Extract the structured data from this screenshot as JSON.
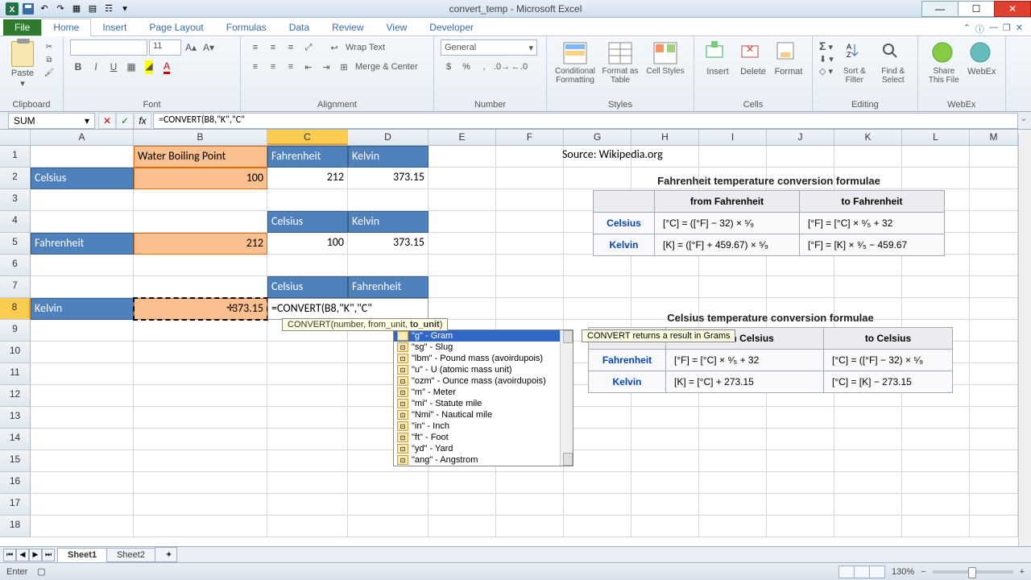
{
  "title": "convert_temp - Microsoft Excel",
  "tabs": {
    "file": "File",
    "list": [
      "Home",
      "Insert",
      "Page Layout",
      "Formulas",
      "Data",
      "Review",
      "View",
      "Developer"
    ],
    "active": 0
  },
  "ribbon": {
    "clipboard": {
      "label": "Clipboard",
      "paste": "Paste"
    },
    "font": {
      "label": "Font",
      "size": "11"
    },
    "alignment": {
      "label": "Alignment",
      "wrap": "Wrap Text",
      "merge": "Merge & Center"
    },
    "number": {
      "label": "Number",
      "format": "General"
    },
    "styles": {
      "label": "Styles",
      "cond": "Conditional Formatting",
      "table": "Format as Table",
      "cell": "Cell Styles"
    },
    "cells": {
      "label": "Cells",
      "insert": "Insert",
      "delete": "Delete",
      "format": "Format"
    },
    "editing": {
      "label": "Editing",
      "sort": "Sort & Filter",
      "find": "Find & Select"
    },
    "share": {
      "share": "Share This File",
      "webex": "WebEx",
      "label": "WebEx"
    }
  },
  "fbar": {
    "namebox": "SUM",
    "formula": "=CONVERT(B8,\"K\",\"C\""
  },
  "columns": [
    "A",
    "B",
    "C",
    "D",
    "E",
    "F",
    "G",
    "H",
    "I",
    "J",
    "K",
    "L",
    "M"
  ],
  "active_col": 2,
  "cells": {
    "B1": "Water Boiling Point",
    "C1": "Fahrenheit",
    "D1": "Kelvin",
    "A2": "Celsius",
    "B2": "100",
    "C2": "212",
    "D2": "373.15",
    "C4": "Celsius",
    "D4": "Kelvin",
    "A5": "Fahrenheit",
    "B5": "212",
    "C5": "100",
    "D5": "373.15",
    "C7": "Celsius",
    "D7": "Fahrenheit",
    "A8": "Kelvin",
    "B8": "373.15",
    "C8_formula": "=CONVERT(B8,\"K\",\"C\"",
    "source": "Source: Wikipedia.org"
  },
  "fn_tip": {
    "prefix": "CONVERT(number, from_unit, ",
    "bold": "to_unit",
    "suffix": ")"
  },
  "dropdown": {
    "items": [
      "\"g\" - Gram",
      "\"sg\" - Slug",
      "\"lbm\" - Pound mass (avoirdupois)",
      "\"u\" - U (atomic mass unit)",
      "\"ozm\" - Ounce mass (avoirdupois)",
      "\"m\" - Meter",
      "\"mi\" - Statute mile",
      "\"Nmi\" - Nautical mile",
      "\"in\" - Inch",
      "\"ft\" - Foot",
      "\"yd\" - Yard",
      "\"ang\" - Angstrom"
    ],
    "selected": 0,
    "help": "CONVERT returns a result in Grams"
  },
  "wiki": {
    "t1": {
      "title": "Fahrenheit temperature conversion formulae",
      "h1": "from Fahrenheit",
      "h2": "to Fahrenheit",
      "r1": "Celsius",
      "r1a": "[°C] = ([°F] − 32) × ⁵⁄₉",
      "r1b": "[°F] = [°C] × ⁹⁄₅ + 32",
      "r2": "Kelvin",
      "r2a": "[K] = ([°F] + 459.67) × ⁵⁄₉",
      "r2b": "[°F] = [K] × ⁹⁄₅ − 459.67"
    },
    "t2": {
      "title": "Celsius temperature conversion formulae",
      "h1": "from Celsius",
      "h2": "to Celsius",
      "r1": "Fahrenheit",
      "r1a": "[°F] = [°C] × ⁹⁄₅ + 32",
      "r1b": "[°C] = ([°F] − 32) × ⁵⁄₉",
      "r2": "Kelvin",
      "r2a": "[K] = [°C] + 273.15",
      "r2b": "[°C] = [K] − 273.15"
    }
  },
  "sheets": {
    "list": [
      "Sheet1",
      "Sheet2"
    ],
    "active": 0
  },
  "status": {
    "mode": "Enter",
    "zoom": "130%"
  }
}
